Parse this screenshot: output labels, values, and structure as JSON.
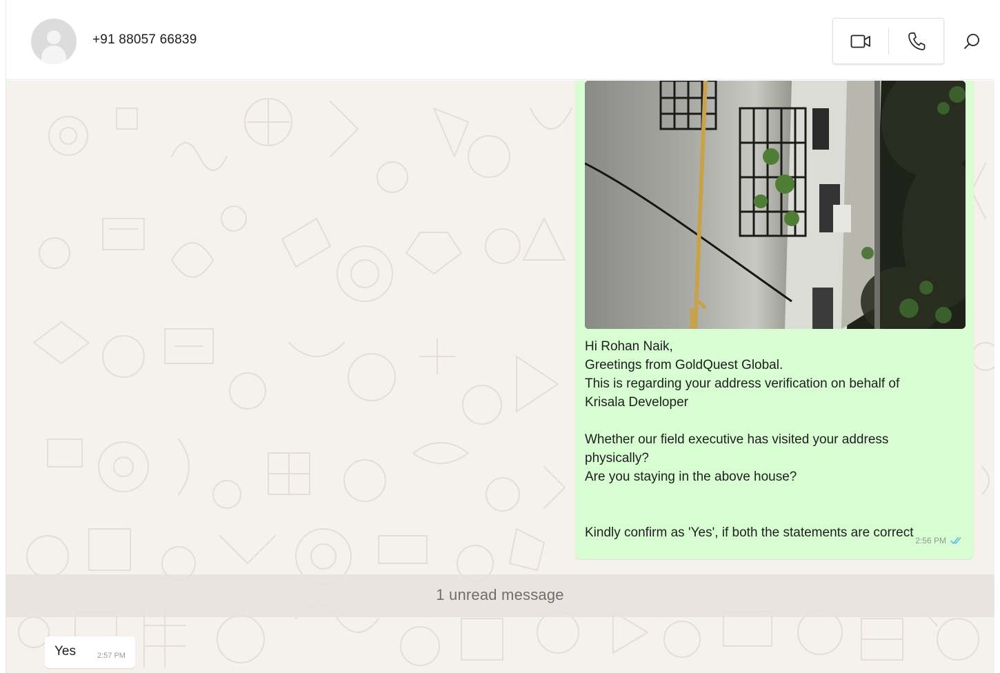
{
  "header": {
    "contact_name": "+91 88057 66839",
    "icons": {
      "avatar": "default-person-avatar",
      "video": "video-camera-icon",
      "voice": "phone-icon",
      "search": "search-icon"
    }
  },
  "messages": {
    "outgoing": {
      "image_description": "exterior wall of an apartment building",
      "lines": [
        "Hi Rohan Naik,",
        "Greetings from GoldQuest Global.",
        "This is regarding your address verification on behalf of",
        "Krisala Developer",
        "Whether our field executive has visited your address",
        "physically?",
        "Are you staying in the above house?",
        "Kindly confirm as 'Yes', if both the statements are correct"
      ],
      "time": "2:56 PM",
      "status_icon": "double-check-read-icon"
    },
    "unread_label": "1 unread message",
    "incoming": {
      "text": "Yes",
      "time": "2:57 PM"
    }
  },
  "colors": {
    "outgoing_bubble": "#d9fdd3",
    "chat_background": "#f5f1ec",
    "read_tick": "#53bdeb"
  }
}
